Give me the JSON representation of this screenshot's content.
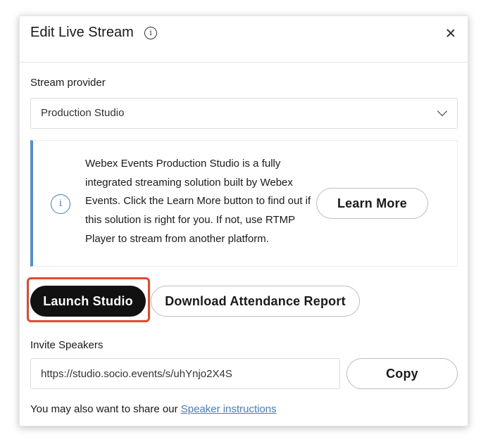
{
  "dialog": {
    "title": "Edit Live Stream",
    "info_icon_glyph": "i",
    "close_icon": "close-icon"
  },
  "stream_provider": {
    "label": "Stream provider",
    "selected": "Production Studio"
  },
  "info_box": {
    "icon_glyph": "i",
    "text": "Webex Events Production Studio is a fully integrated streaming solution built by Webex Events. Click the Learn More button to find out if this solution is right for you. If not, use RTMP Player to stream from another platform.",
    "learn_more_label": "Learn More",
    "accent_color": "#4a90e2"
  },
  "actions": {
    "launch_label": "Launch Studio",
    "download_label": "Download Attendance Report",
    "highlight_color": "#e8472a"
  },
  "invite": {
    "label": "Invite Speakers",
    "url": "https://studio.socio.events/s/uhYnjo2X4S",
    "copy_label": "Copy"
  },
  "footer": {
    "text": "You may also want to share our ",
    "link_label": "Speaker instructions"
  }
}
